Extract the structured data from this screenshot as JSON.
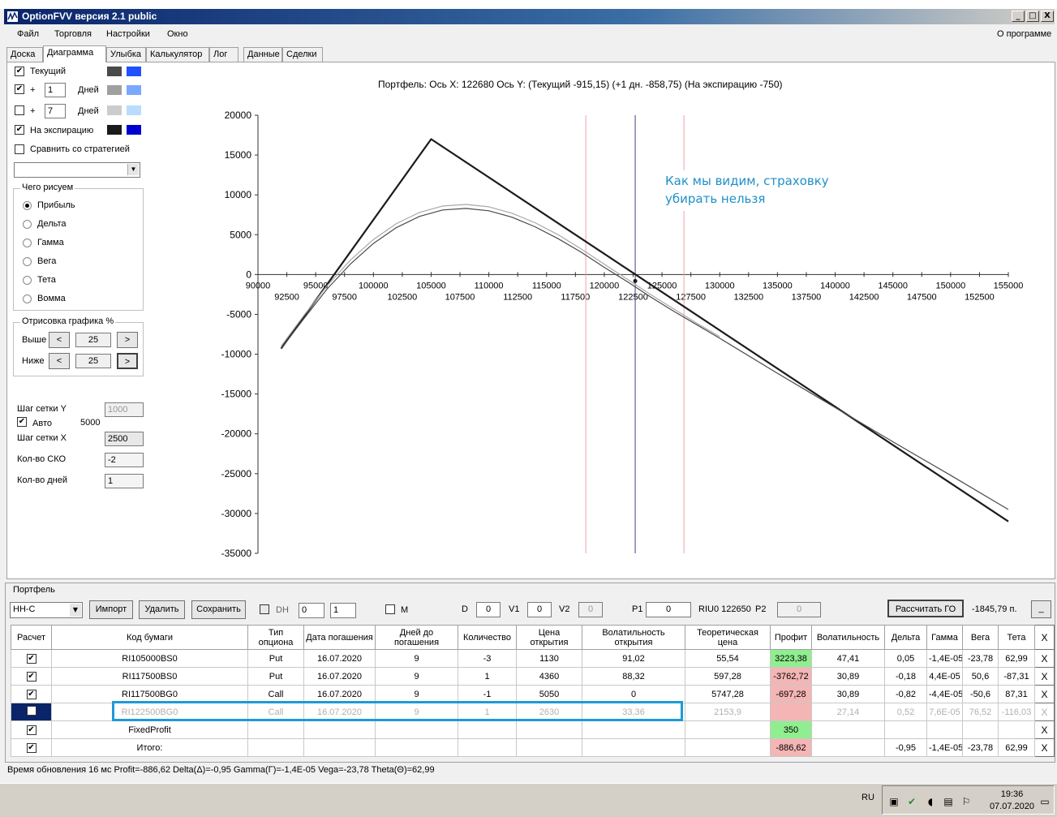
{
  "window": {
    "title": "OptionFVV версия 2.1 public",
    "buttons": {
      "minimize": "_",
      "maximize": "□",
      "close": "X"
    }
  },
  "menu": {
    "items": [
      "Файл",
      "Торговля",
      "Настройки",
      "Окно"
    ],
    "about": "О программе"
  },
  "tabs": [
    "Доска",
    "Диаграмма",
    "Улыбка",
    "Калькулятор",
    "Лог",
    "Данные",
    "Сделки"
  ],
  "sidebar": {
    "current": {
      "label": "Текущий",
      "checked": true,
      "colors": [
        "#4a4a4a",
        "#2050ff"
      ]
    },
    "plus1": {
      "plus": "+",
      "value": "1",
      "days": "Дней",
      "checked": true,
      "colors": [
        "#a0a0a0",
        "#7aa8ff"
      ]
    },
    "plus7": {
      "plus": "+",
      "value": "7",
      "days": "Дней",
      "checked": false,
      "colors": [
        "#cccccc",
        "#b8dcff"
      ]
    },
    "expiry": {
      "label": "На экспирацию",
      "checked": true,
      "colors": [
        "#1a1a1a",
        "#0000d0"
      ]
    },
    "compare": {
      "label": "Сравнить со стратегией",
      "checked": false
    },
    "draw_group": {
      "title": "Чего рисуем",
      "options": [
        "Прибыль",
        "Дельта",
        "Гамма",
        "Вега",
        "Тета",
        "Вомма"
      ],
      "selected": 0
    },
    "render_group": {
      "title": "Отрисовка графика %",
      "above_label": "Выше",
      "above_value": "25",
      "below_label": "Ниже",
      "below_value": "25",
      "left_btn": "<",
      "right_btn": ">"
    },
    "grid_y": {
      "label": "Шаг сетки Y",
      "value": "1000"
    },
    "auto": {
      "label": "Авто",
      "value": "5000",
      "checked": true
    },
    "grid_x": {
      "label": "Шаг сетки X",
      "value": "2500"
    },
    "sko": {
      "label": "Кол-во СКО",
      "value": "-2"
    },
    "days": {
      "label": "Кол-во дней",
      "value": "1"
    }
  },
  "chart_header": "Портфель: Ось X: 122680 Ось Y:  (Текущий -915,15)  (+1 дн. -858,75)  (На экспирацию -750)",
  "callout": {
    "line1": "Как мы видим, страховку",
    "line2": "убирать нельзя"
  },
  "chart_data": {
    "type": "line",
    "xlim": [
      90000,
      155000
    ],
    "ylim": [
      -35000,
      20000
    ],
    "x_ticks_top": [
      90000,
      95000,
      100000,
      105000,
      110000,
      115000,
      120000,
      125000,
      130000,
      135000,
      140000,
      145000,
      150000,
      155000
    ],
    "x_ticks_bottom": [
      92500,
      97500,
      102500,
      107500,
      112500,
      117500,
      122500,
      127500,
      132500,
      137500,
      142500,
      147500,
      152500
    ],
    "y_ticks": [
      20000,
      15000,
      10000,
      5000,
      0,
      -5000,
      -10000,
      -15000,
      -20000,
      -25000,
      -30000,
      -35000
    ],
    "cursor_x": 122680,
    "sigma_lines": [
      118400,
      126900
    ],
    "series": [
      {
        "color": "#1a1a1a",
        "width": 2.2,
        "x": [
          92000,
          105000,
          155000
        ],
        "y": [
          -9300,
          17000,
          -31000
        ]
      },
      {
        "color": "#4a4a4a",
        "width": 1.2,
        "x": [
          92000,
          94000,
          96000,
          98000,
          100000,
          102000,
          104000,
          106000,
          108000,
          110000,
          112000,
          114000,
          116000,
          118000,
          120000,
          122000,
          124000,
          126000,
          128000,
          130000,
          135000,
          140000,
          145000,
          150000,
          155000
        ],
        "y": [
          -9300,
          -5500,
          -1800,
          1300,
          3900,
          5900,
          7300,
          8100,
          8300,
          8000,
          7200,
          6000,
          4500,
          2800,
          900,
          -900,
          -2800,
          -4600,
          -6300,
          -8000,
          -12400,
          -16700,
          -21000,
          -25200,
          -29500
        ]
      },
      {
        "color": "#a8a8a8",
        "width": 1.2,
        "x": [
          92000,
          94000,
          96000,
          98000,
          100000,
          102000,
          104000,
          106000,
          108000,
          110000,
          112000,
          114000,
          116000,
          118000,
          120000,
          122000,
          124000,
          126000,
          128000,
          130000
        ],
        "y": [
          -9000,
          -5100,
          -1400,
          1800,
          4400,
          6400,
          7800,
          8600,
          8800,
          8500,
          7700,
          6500,
          5000,
          3200,
          1300,
          -600,
          -2500,
          -4300,
          -6100,
          -7800
        ]
      }
    ]
  },
  "portfolio": {
    "title": "Портфель",
    "select_value": "НН-С",
    "import_btn": "Импорт",
    "delete_btn": "Удалить",
    "save_btn": "Сохранить",
    "dh_label": "DH",
    "dh_value1": "0",
    "dh_value2": "1",
    "m_label": "M",
    "d_label": "D",
    "d_value": "0",
    "v1_label": "V1",
    "v1_value": "0",
    "v2_label": "V2",
    "v2_value": "0",
    "p1_label": "P1",
    "p1_value": "0",
    "riu_label": "RIU0 122650",
    "p2_label": "P2",
    "p2_value": "0",
    "go_btn": "Рассчитать ГО",
    "go_value": "-1845,79 п.",
    "small_btn": "_"
  },
  "table": {
    "headers": [
      "Расчет",
      "Код бумаги",
      "Тип опциона",
      "Дата погашения",
      "Дней до погашения",
      "Количество",
      "Цена открытия",
      "Волатильность открытия",
      "Теоретическая цена",
      "Профит",
      "Волатильность",
      "Дельта",
      "Гамма",
      "Вега",
      "Тета",
      "X"
    ],
    "rows": [
      {
        "code": "RI105000BS0",
        "type": "Put",
        "date": "16.07.2020",
        "days": "9",
        "qty": "-3",
        "price": "1130",
        "vol_open": "91,02",
        "theo": "55,54",
        "profit": "3223,38",
        "vol": "47,41",
        "delta": "0,05",
        "gamma": "-1,4E-05",
        "vega": "-23,78",
        "theta": "62,99",
        "x": "X",
        "check": "✔"
      },
      {
        "code": "RI117500BS0",
        "type": "Put",
        "date": "16.07.2020",
        "days": "9",
        "qty": "1",
        "price": "4360",
        "vol_open": "88,32",
        "theo": "597,28",
        "profit": "-3762,72",
        "vol": "30,89",
        "delta": "-0,18",
        "gamma": "4,4E-05",
        "vega": "50,6",
        "theta": "-87,31",
        "x": "X",
        "check": "✔"
      },
      {
        "code": "RI117500BG0",
        "type": "Call",
        "date": "16.07.2020",
        "days": "9",
        "qty": "-1",
        "price": "5050",
        "vol_open": "0",
        "theo": "5747,28",
        "profit": "-697,28",
        "vol": "30,89",
        "delta": "-0,82",
        "gamma": "-4,4E-05",
        "vega": "-50,6",
        "theta": "87,31",
        "x": "X",
        "check": "✔"
      },
      {
        "code": "RI122500BG0",
        "type": "Call",
        "date": "16.07.2020",
        "days": "9",
        "qty": "1",
        "price": "2630",
        "vol_open": "33,36",
        "theo": "2153,9",
        "profit": "",
        "vol": "27,14",
        "delta": "0,52",
        "gamma": "7,6E-05",
        "vega": "76,52",
        "theta": "-116,03",
        "x": "X",
        "check": ""
      }
    ],
    "fixed": {
      "label": "FixedProfit",
      "profit": "350",
      "check": "✔",
      "x": "X"
    },
    "total": {
      "label": "Итого:",
      "profit": "-886,62",
      "delta": "-0,95",
      "gamma": "-1,4E-05",
      "vega": "-23,78",
      "theta": "62,99",
      "check": "✔",
      "x": "X"
    }
  },
  "status": "Время обновления 16 мс  Profit=-886,62 Delta(Δ)=-0,95 Gamma(Γ)=-1,4E-05 Vega=-23,78 Theta(Θ)=62,99",
  "taskbar": {
    "lang": "RU",
    "time": "19:36",
    "date": "07.07.2020"
  }
}
